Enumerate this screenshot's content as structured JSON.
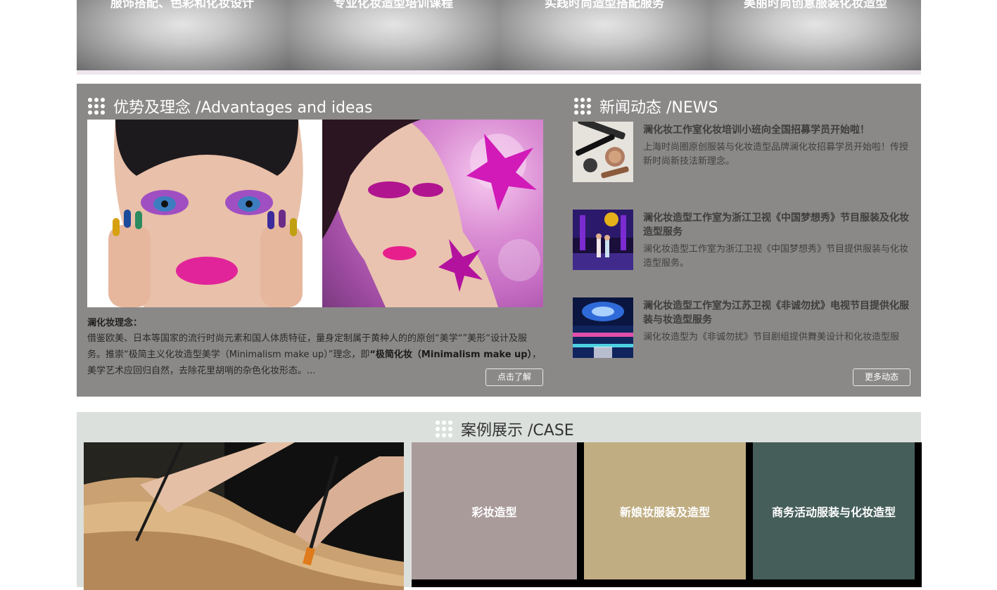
{
  "banner": {
    "captions": [
      "服饰搭配、色彩和化妆设计",
      "专业化妆造型培训课程",
      "实践时尚造型搭配服务",
      "美丽时尚创意服装化妆造型"
    ]
  },
  "advantages": {
    "title": "优势及理念 /Advantages and ideas",
    "label": "澜化妆理念：",
    "text_1": "借鉴欧美、日本等国家的流行时尚元素和国人体质特征，量身定制属于黄种人的的原创“美学“”美形“设计及服务。推崇“极简主义化妆造型美学（Minimalism make up）”理念，即",
    "text_bold": "“极简化妆（Minimalism make up）",
    "text_2": "，美学艺术应回归自然，去除花里胡哨的杂色化妆形态。...",
    "button": "点击了解"
  },
  "news": {
    "title": "新闻动态 /NEWS",
    "items": [
      {
        "title": "澜化妆工作室化妆培训小班向全国招募学员开始啦！",
        "desc": "上海时尚圈原创服装与化妆造型品牌澜化妆招募学员开始啦！传授新时尚新技法新理念。"
      },
      {
        "title": "澜化妆造型工作室为浙江卫视《中国梦想秀》节目服装及化妆造型服务",
        "desc": "澜化妆造型工作室为浙江卫视《中国梦想秀》节目提供服装与化妆造型服务。"
      },
      {
        "title": "澜化妆造型工作室为江苏卫视《非诚勿扰》电视节目提供化服装与妆造型服务",
        "desc": "澜化妆造型为《非诚勿扰》节目剧组提供舞美设计和化妆造型服"
      }
    ],
    "button": "更多动态"
  },
  "cases": {
    "title": "案例展示 /CASE",
    "tiles": [
      {
        "label": "彩妆造型",
        "color": "#aa9b9b"
      },
      {
        "label": "新娘妆服装及造型",
        "color": "#c0ad82"
      },
      {
        "label": "商务活动服装与化妆造型",
        "color": "#455e59"
      }
    ]
  }
}
